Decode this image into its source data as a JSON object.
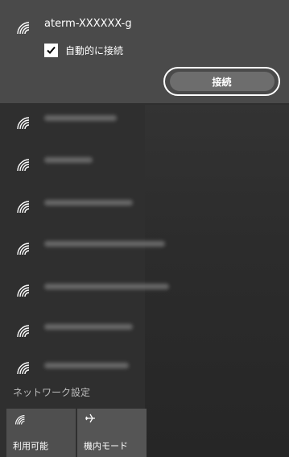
{
  "network": {
    "ssid": "aterm-XXXXXX-g",
    "auto_connect_label": "自動的に接続",
    "auto_connect_checked": true,
    "connect_label": "接続"
  },
  "other_networks": [
    {
      "name": "",
      "icon": "wifi-icon"
    },
    {
      "name": "",
      "icon": "wifi-icon"
    },
    {
      "name": "",
      "icon": "wifi-icon"
    },
    {
      "name": "",
      "icon": "wifi-icon"
    },
    {
      "name": "",
      "icon": "wifi-icon"
    },
    {
      "name": "",
      "icon": "wifi-icon"
    },
    {
      "name": "",
      "icon": "wifi-icon"
    }
  ],
  "footer": {
    "settings_label": "ネットワーク設定",
    "tiles": [
      {
        "label": "利用可能",
        "icon": "wifi-icon",
        "active": true
      },
      {
        "label": "機内モード",
        "icon": "airplane-icon",
        "active": false
      }
    ]
  },
  "colors": {
    "panel": "#2f2f2f",
    "selected": "#4a4a4a",
    "connect_button": "#6d6d6d",
    "tile_active": "#4f4f4f",
    "tile_inactive": "#555555"
  }
}
